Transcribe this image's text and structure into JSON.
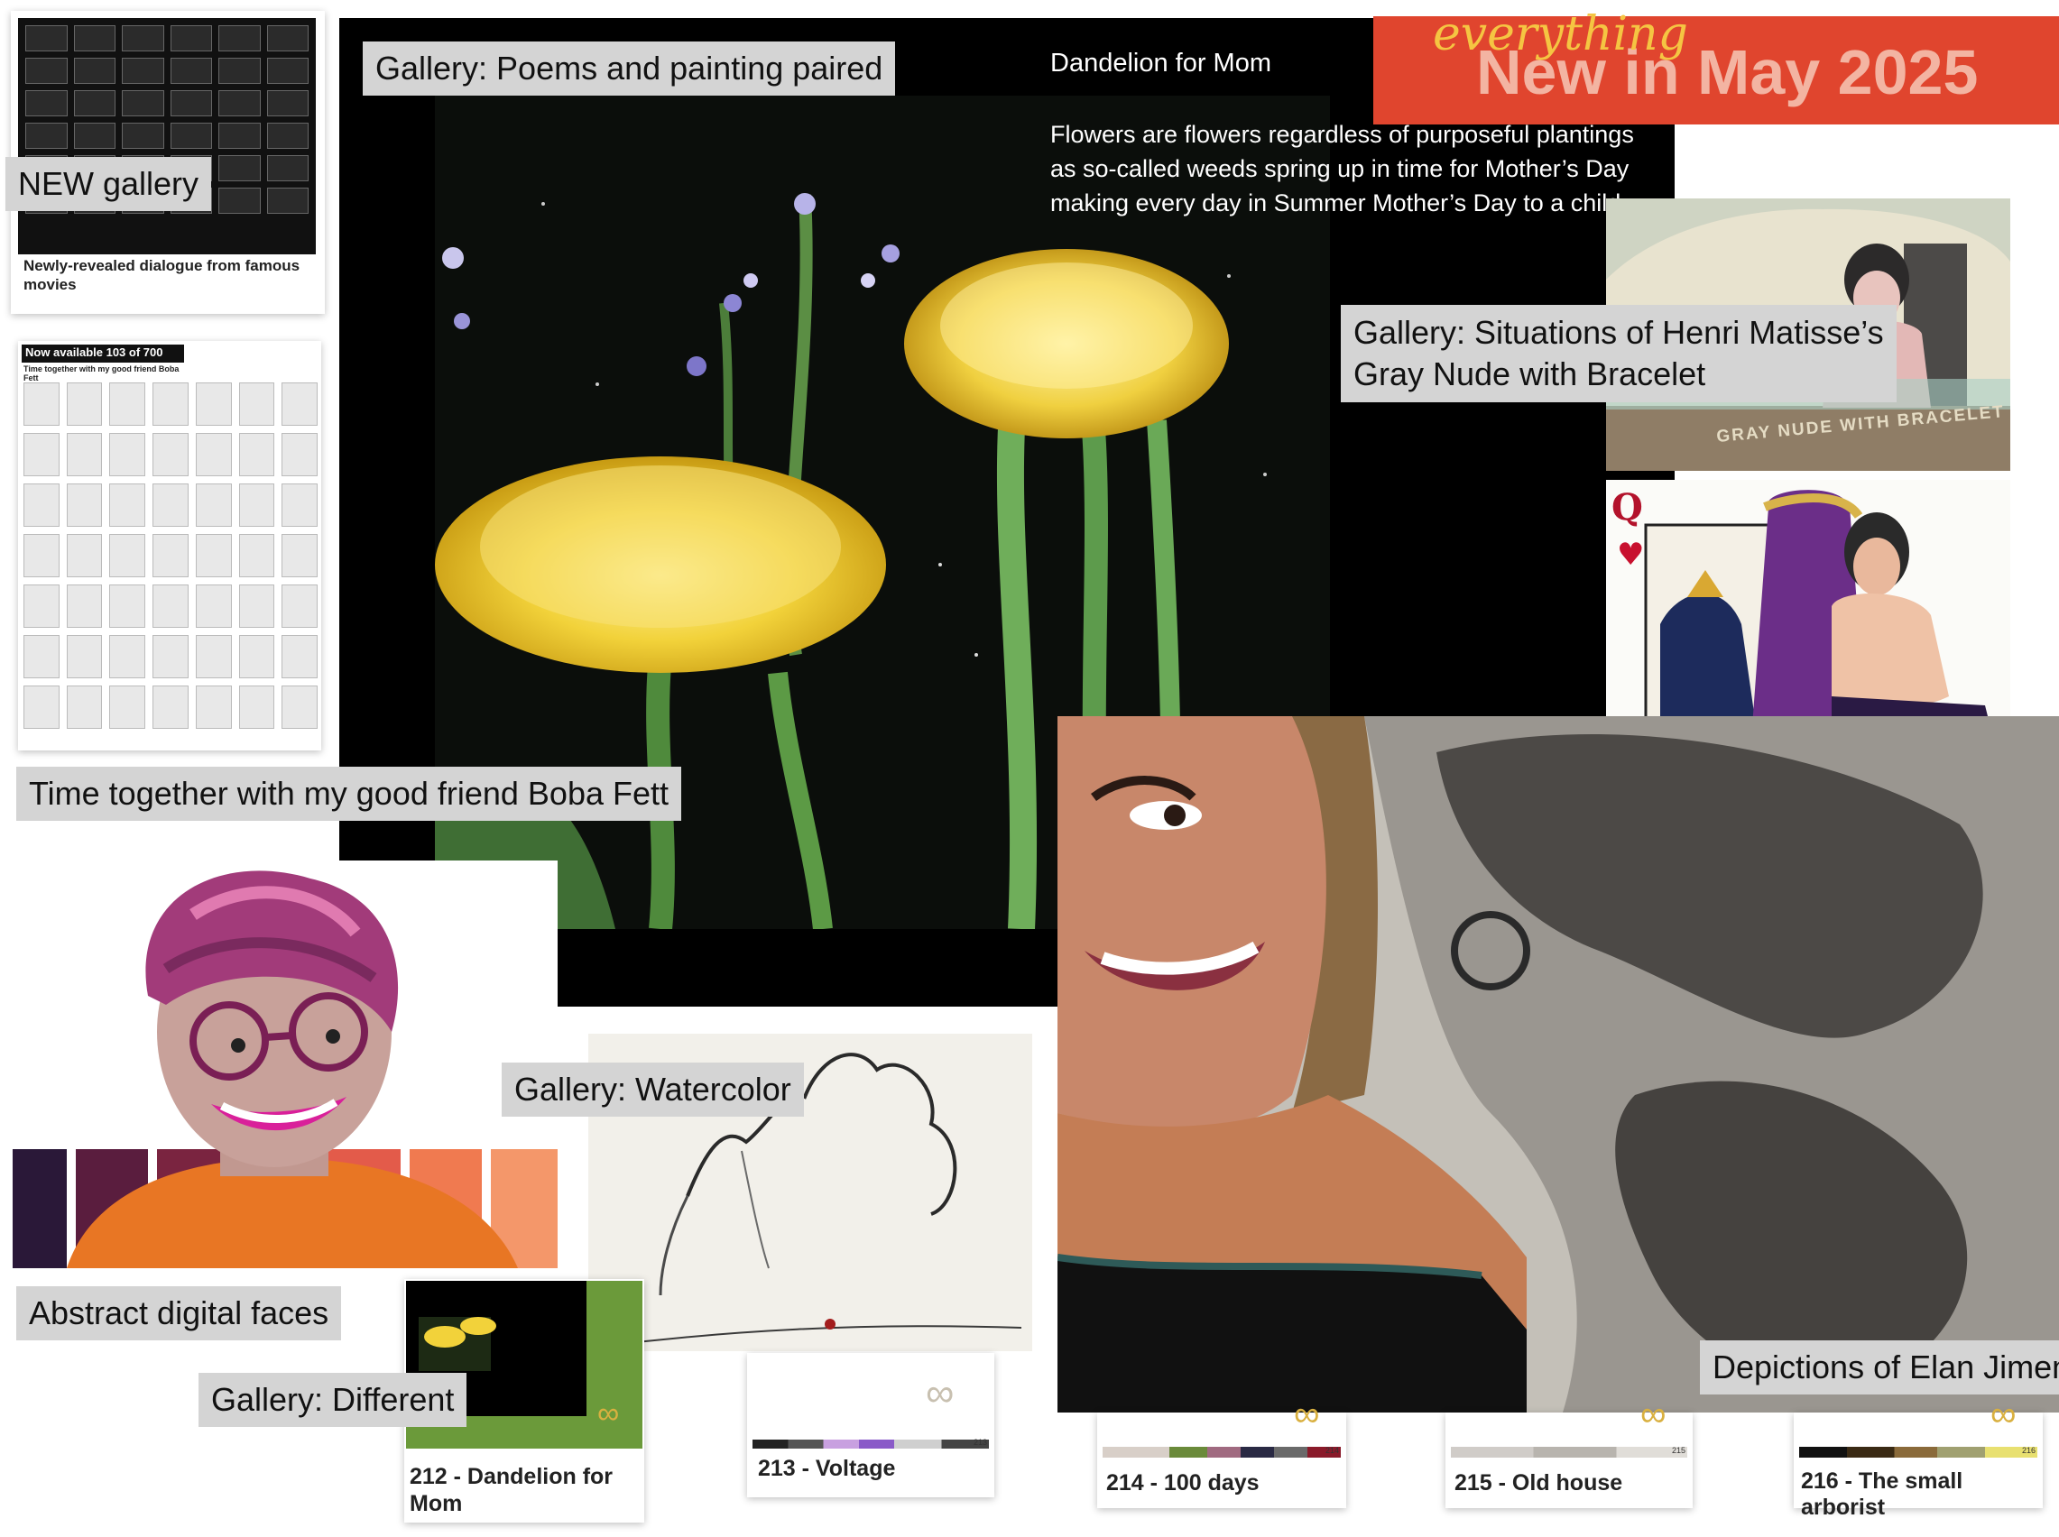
{
  "banner": {
    "script_word": "everything",
    "title": "New in May 2025",
    "bg_color": "#e0452e",
    "title_color": "#f3b4a2",
    "script_color": "#f5c542"
  },
  "thumbs": {
    "movies_caption": "Newly-revealed dialogue from famous movies",
    "boba_header": "Now available 103 of 700",
    "boba_subheader": "Time together with my good friend Boba Fett"
  },
  "labels": {
    "new_gallery": "NEW gallery",
    "poems": "Gallery: Poems and painting paired",
    "boba": "Time together with my good friend Boba Fett",
    "matisse_line1": "Gallery: Situations of Henri Matisse’s",
    "matisse_line2": "Gray Nude with Bracelet",
    "watercolor": "Gallery: Watercolor",
    "abstract_faces": "Abstract digital faces",
    "different": "Gallery: Different",
    "elan": "Depictions of Elan Jimenez"
  },
  "poem": {
    "title": "Dandelion for Mom",
    "lines": [
      "Flowers are flowers regardless of purposeful plantings",
      "as so-called weeds spring up in time for Mother’s Day",
      "making every day in Summer Mother’s Day to a child."
    ]
  },
  "matisse_image_text": "GRAY NUDE WITH BRACELET",
  "cards": [
    {
      "title": "212 - Dandelion for Mom",
      "number": "212"
    },
    {
      "title": "213 - Voltage",
      "number": "213"
    },
    {
      "title": "214 - 100 days",
      "number": "214"
    },
    {
      "title": "215 - Old house",
      "number": "215"
    },
    {
      "title": "216 - The small arborist",
      "number": "216"
    }
  ],
  "colors": {
    "label_bg": "#d4d4d4",
    "poem_bg": "#000000",
    "dandelion": "#f2d23a"
  }
}
